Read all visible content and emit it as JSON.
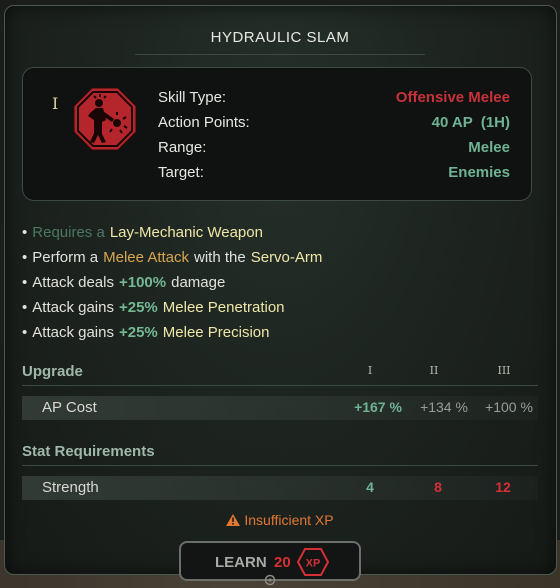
{
  "tooltip": {
    "title": "HYDRAULIC SLAM",
    "tier_marker": "I",
    "icon": "figure-striking-hazard-icon",
    "info": [
      {
        "key": "Skill Type:",
        "value": "Offensive Melee",
        "color": "red"
      },
      {
        "key": "Action Points:",
        "value": "40 AP  (1H)",
        "color": "green"
      },
      {
        "key": "Range:",
        "value": "Melee",
        "color": "green"
      },
      {
        "key": "Target:",
        "value": "Enemies",
        "color": "green"
      }
    ],
    "effects": [
      {
        "prefix": "Requires a",
        "highlight": "Lay-Mechanic Weapon"
      },
      {
        "prefix": "Perform a",
        "highlight": "Melee Attack",
        "mid": "with the",
        "highlight2": "Servo-Arm"
      },
      {
        "prefix": "Attack deals",
        "highlight": "+100%",
        "suffix": "damage"
      },
      {
        "prefix": "Attack gains",
        "highlight": "+25%",
        "suffix": "Melee Penetration"
      },
      {
        "prefix": "Attack gains",
        "highlight": "+25%",
        "suffix": "Melee Precision"
      }
    ],
    "bullet": "•",
    "upgrade": {
      "header": "Upgrade",
      "tiers": [
        "I",
        "II",
        "III"
      ],
      "row_label": "AP Cost",
      "values": [
        "+167 %",
        "+134 %",
        "+100 %"
      ]
    },
    "stat_requirements": {
      "header": "Stat Requirements",
      "row_label": "Strength",
      "values": [
        "4",
        "8",
        "12"
      ]
    },
    "warning": "Insufficient XP",
    "warning_icon": "warning-triangle-icon",
    "learn": {
      "label": "LEARN",
      "cost": "20",
      "badge": "XP"
    },
    "colors": {
      "red": "#c8323a",
      "green": "#6fb394",
      "yellow": "#efe7a8",
      "orange": "#d8a650",
      "warning": "#e07832"
    }
  }
}
